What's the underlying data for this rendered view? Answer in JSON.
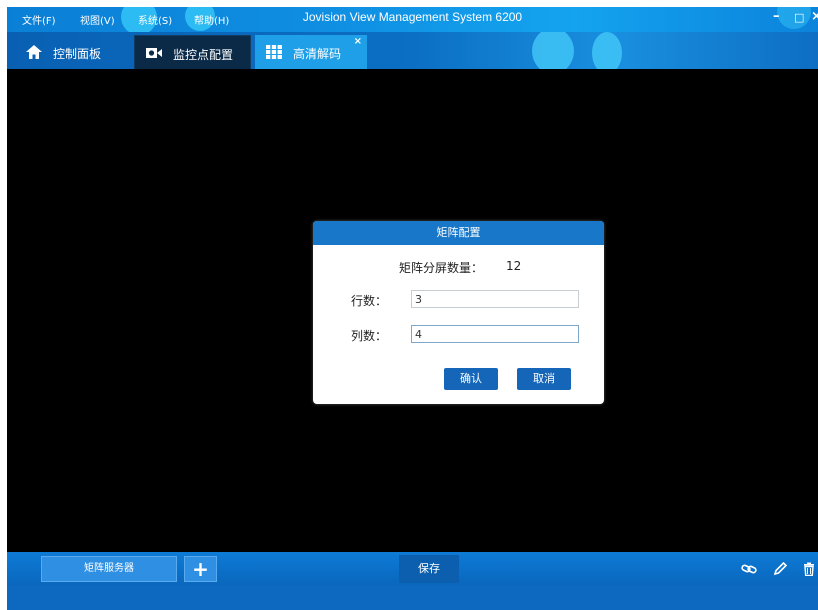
{
  "window": {
    "title": "Jovision View Management System 6200",
    "minimize": "–",
    "maximize": "□",
    "close": "×"
  },
  "menu": [
    {
      "label": "文件(F)"
    },
    {
      "label": "视图(V)"
    },
    {
      "label": "系统(S)"
    },
    {
      "label": "帮助(H)"
    }
  ],
  "tabs": [
    {
      "label": "控制面板",
      "icon": "home-icon"
    },
    {
      "label": "监控点配置",
      "icon": "camera-icon"
    },
    {
      "label": "高清解码",
      "icon": "grid-icon",
      "active": true,
      "close": "×"
    }
  ],
  "dialog": {
    "title": "矩阵配置",
    "split_label": "矩阵分屏数量：",
    "split_value": "12",
    "rows_label": "行数：",
    "rows_value": "3",
    "cols_label": "列数：",
    "cols_value": "4",
    "confirm": "确认",
    "cancel": "取消"
  },
  "bottom": {
    "matrix_server": "矩阵服务器",
    "add": "+",
    "save": "保存",
    "tools": [
      "link-icon",
      "pencil-icon",
      "trash-icon"
    ]
  },
  "colors": {
    "title_bar": "#0f8fe2",
    "tab_active": "#1f9fe8",
    "dialog_header": "#1877c9",
    "button": "#1565b8"
  }
}
